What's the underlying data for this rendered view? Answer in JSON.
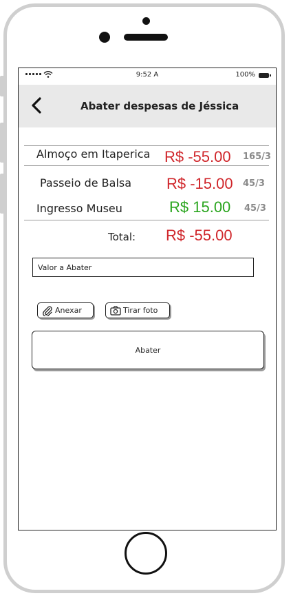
{
  "status_bar": {
    "time": "9:52 A",
    "battery": "100%"
  },
  "header": {
    "title": "Abater despesas de Jéssica"
  },
  "expenses": [
    {
      "name": "Almoço em Itaperica",
      "value": "R$ -55.00",
      "split": "165/3",
      "sign": "negative"
    },
    {
      "name": "Passeio de Balsa",
      "value": "R$ -15.00",
      "split": "45/3",
      "sign": "negative"
    },
    {
      "name": "Ingresso Museu",
      "value": "R$ 15.00",
      "split": "45/3",
      "sign": "positive"
    }
  ],
  "total": {
    "label": "Total:",
    "value": "R$ -55.00"
  },
  "form": {
    "amount_placeholder": "Valor a Abater",
    "attach_label": "Anexar",
    "photo_label": "Tirar foto",
    "submit_label": "Abater"
  },
  "colors": {
    "negative": "#d0262b",
    "positive": "#2aa51e",
    "split": "#8a8a8a",
    "navbar": "#e9e9e9"
  },
  "icons": {
    "back": "chevron-left-icon",
    "attach": "paperclip-icon",
    "photo": "camera-icon",
    "wifi": "wifi-icon",
    "battery": "battery-icon"
  }
}
